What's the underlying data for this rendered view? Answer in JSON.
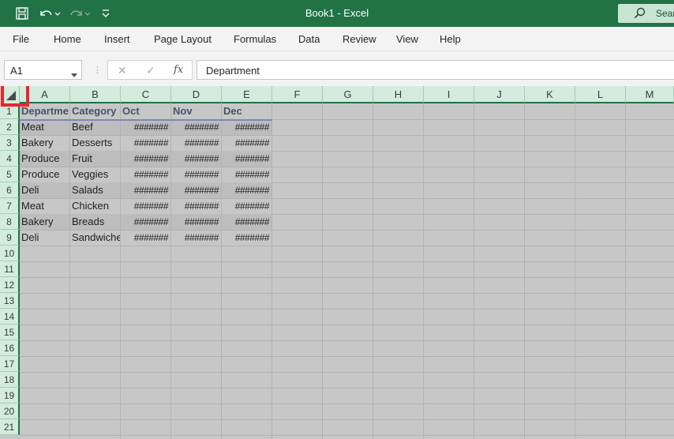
{
  "window": {
    "title": "Book1  -  Excel",
    "search_label": "Sear"
  },
  "menu": [
    "File",
    "Home",
    "Insert",
    "Page Layout",
    "Formulas",
    "Data",
    "Review",
    "View",
    "Help"
  ],
  "formula_bar": {
    "name_box": "A1",
    "fx_label": "fx",
    "content": "Department"
  },
  "columns": [
    "A",
    "B",
    "C",
    "D",
    "E",
    "F",
    "G",
    "H",
    "I",
    "J",
    "K",
    "L",
    "M"
  ],
  "rows": [
    "1",
    "2",
    "3",
    "4",
    "5",
    "6",
    "7",
    "8",
    "9",
    "10",
    "11",
    "12",
    "13",
    "14",
    "15",
    "16",
    "17",
    "18",
    "19",
    "20",
    "21"
  ],
  "table": {
    "headers": [
      "Departme",
      "Category",
      "Oct",
      "Nov",
      "Dec"
    ],
    "rows": [
      [
        "Meat",
        "Beef",
        "#######",
        "#######",
        "#######"
      ],
      [
        "Bakery",
        "Desserts",
        "#######",
        "#######",
        "#######"
      ],
      [
        "Produce",
        "Fruit",
        "#######",
        "#######",
        "#######"
      ],
      [
        "Produce",
        "Veggies",
        "#######",
        "#######",
        "#######"
      ],
      [
        "Deli",
        "Salads",
        "#######",
        "#######",
        "#######"
      ],
      [
        "Meat",
        "Chicken",
        "#######",
        "#######",
        "#######"
      ],
      [
        "Bakery",
        "Breads",
        "#######",
        "#######",
        "#######"
      ],
      [
        "Deli",
        "Sandwiche",
        "#######",
        "#######",
        "#######"
      ]
    ]
  },
  "icons": {
    "save": "save-icon",
    "undo": "undo-icon",
    "redo": "redo-icon",
    "customize": "customize-qat-icon",
    "search": "search-icon",
    "select_all": "select-all-triangle-icon"
  }
}
